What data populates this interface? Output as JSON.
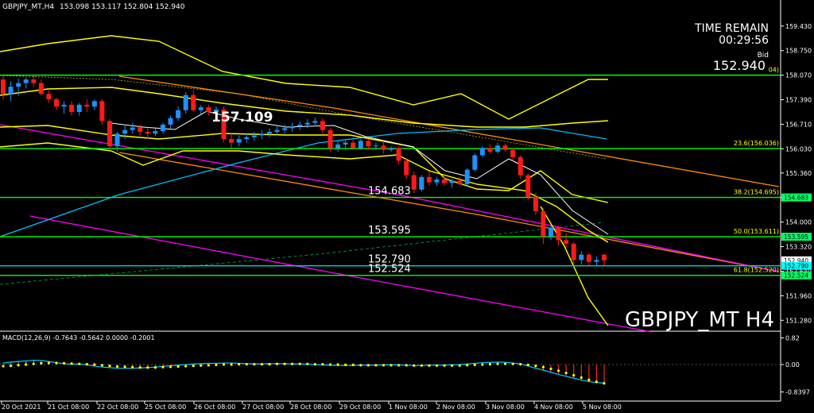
{
  "header": {
    "symbol": "GBPJPY_MT,H4",
    "ohlc": "153.098 153.117 152.804 152.940"
  },
  "watermark": "GBPJPY_MT H4",
  "timer": {
    "label": "TIME REMAIN",
    "value": "00:29:56",
    "bid_label": "Bid",
    "bid_value": "152.940"
  },
  "colors": {
    "background": "#000000",
    "bull": "#1e90ff",
    "bear": "#ff1a1a",
    "level_line": "#00ff00",
    "trend_upper": "#ff8c00",
    "trend_channel": "#ff00ff",
    "envelope": "#ffff00",
    "ma_fast": "#ffffff",
    "ma_slow": "#00bfff",
    "macd_signal": "#ffff00",
    "macd_main": "#00ccff"
  },
  "chart_data": {
    "type": "candlestick",
    "price_axis": {
      "ticks": [
        "159.430",
        "158.750",
        "158.070",
        "157.390",
        "156.710",
        "156.030",
        "155.360",
        "154.680",
        "154.000",
        "153.320",
        "152.640",
        "151.960",
        "151.280"
      ],
      "ylim": [
        151.0,
        159.8
      ]
    },
    "time_axis": {
      "ticks": [
        "20 Oct 2021",
        "21 Oct 08:00",
        "22 Oct 08:00",
        "25 Oct 08:00",
        "26 Oct 08:00",
        "27 Oct 08:00",
        "28 Oct 08:00",
        "29 Oct 08:00",
        "1 Nov 08:00",
        "2 Nov 08:00",
        "3 Nov 08:00",
        "4 Nov 08:00",
        "5 Nov 08:00"
      ]
    },
    "candles": [
      [
        157.95,
        158.05,
        157.4,
        157.55
      ],
      [
        157.55,
        157.9,
        157.35,
        157.75
      ],
      [
        157.75,
        157.98,
        157.5,
        157.85
      ],
      [
        157.85,
        158.0,
        157.7,
        157.95
      ],
      [
        157.95,
        158.05,
        157.75,
        157.85
      ],
      [
        157.85,
        157.95,
        157.5,
        157.55
      ],
      [
        157.55,
        157.65,
        157.3,
        157.4
      ],
      [
        157.4,
        157.45,
        157.1,
        157.2
      ],
      [
        157.2,
        157.35,
        157.0,
        157.25
      ],
      [
        157.25,
        157.35,
        156.95,
        157.05
      ],
      [
        157.05,
        157.3,
        156.95,
        157.25
      ],
      [
        157.25,
        157.4,
        157.05,
        157.2
      ],
      [
        157.2,
        157.4,
        157.1,
        157.35
      ],
      [
        157.35,
        157.4,
        156.7,
        156.8
      ],
      [
        156.8,
        156.85,
        156.0,
        156.1
      ],
      [
        156.1,
        156.5,
        155.95,
        156.45
      ],
      [
        156.45,
        156.7,
        156.3,
        156.55
      ],
      [
        156.55,
        156.75,
        156.45,
        156.62
      ],
      [
        156.62,
        156.7,
        156.4,
        156.5
      ],
      [
        156.5,
        156.62,
        156.3,
        156.45
      ],
      [
        156.45,
        156.6,
        156.38,
        156.52
      ],
      [
        156.52,
        156.75,
        156.45,
        156.7
      ],
      [
        156.7,
        156.95,
        156.6,
        156.88
      ],
      [
        156.88,
        157.2,
        156.8,
        157.1
      ],
      [
        157.1,
        157.6,
        157.0,
        157.52
      ],
      [
        157.52,
        157.65,
        157.05,
        157.1
      ],
      [
        157.1,
        157.25,
        157.0,
        157.18
      ],
      [
        157.18,
        157.25,
        156.95,
        157.05
      ],
      [
        157.05,
        157.2,
        156.95,
        157.12
      ],
      [
        157.12,
        157.2,
        156.2,
        156.3
      ],
      [
        156.3,
        156.45,
        156.05,
        156.2
      ],
      [
        156.2,
        156.4,
        156.1,
        156.3
      ],
      [
        156.3,
        156.45,
        156.2,
        156.35
      ],
      [
        156.35,
        156.5,
        156.25,
        156.4
      ],
      [
        156.4,
        156.55,
        156.3,
        156.45
      ],
      [
        156.45,
        156.6,
        156.35,
        156.5
      ],
      [
        156.5,
        156.65,
        156.4,
        156.55
      ],
      [
        156.55,
        156.7,
        156.45,
        156.6
      ],
      [
        156.6,
        156.75,
        156.5,
        156.65
      ],
      [
        156.65,
        156.8,
        156.55,
        156.7
      ],
      [
        156.7,
        156.85,
        156.6,
        156.75
      ],
      [
        156.75,
        156.9,
        156.65,
        156.8
      ],
      [
        156.8,
        156.88,
        156.45,
        156.55
      ],
      [
        156.55,
        156.6,
        155.95,
        156.05
      ],
      [
        156.05,
        156.25,
        155.95,
        156.15
      ],
      [
        156.15,
        156.3,
        156.0,
        156.2
      ],
      [
        156.2,
        156.3,
        156.0,
        156.05
      ],
      [
        156.05,
        156.3,
        156.0,
        156.25
      ],
      [
        156.25,
        156.3,
        156.0,
        156.1
      ],
      [
        156.1,
        156.2,
        156.0,
        156.12
      ],
      [
        156.12,
        156.25,
        155.9,
        156.0
      ],
      [
        156.0,
        156.1,
        155.95,
        156.05
      ],
      [
        156.05,
        156.1,
        155.6,
        155.7
      ],
      [
        155.7,
        155.75,
        155.2,
        155.3
      ],
      [
        155.3,
        155.4,
        154.8,
        154.9
      ],
      [
        154.9,
        155.3,
        154.85,
        155.25
      ],
      [
        155.25,
        155.4,
        155.0,
        155.1
      ],
      [
        155.1,
        155.25,
        155.0,
        155.18
      ],
      [
        155.18,
        155.25,
        155.0,
        155.08
      ],
      [
        155.08,
        155.2,
        154.95,
        155.15
      ],
      [
        155.15,
        155.25,
        155.0,
        155.05
      ],
      [
        155.05,
        155.5,
        155.0,
        155.45
      ],
      [
        155.45,
        155.9,
        155.4,
        155.85
      ],
      [
        155.85,
        156.1,
        155.8,
        156.05
      ],
      [
        156.05,
        156.15,
        155.9,
        155.95
      ],
      [
        155.95,
        156.2,
        155.9,
        156.12
      ],
      [
        156.12,
        156.18,
        155.95,
        156.0
      ],
      [
        156.0,
        156.05,
        155.7,
        155.8
      ],
      [
        155.8,
        155.85,
        155.2,
        155.3
      ],
      [
        155.3,
        155.35,
        154.6,
        154.7
      ],
      [
        154.7,
        154.8,
        154.2,
        154.3
      ],
      [
        154.3,
        154.4,
        153.4,
        153.6
      ],
      [
        153.6,
        153.9,
        153.5,
        153.85
      ],
      [
        153.85,
        153.9,
        153.35,
        153.5
      ],
      [
        153.5,
        153.7,
        153.3,
        153.4
      ],
      [
        153.4,
        153.45,
        152.8,
        152.95
      ],
      [
        152.95,
        153.2,
        152.85,
        153.1
      ],
      [
        153.1,
        153.15,
        152.8,
        152.9
      ],
      [
        152.9,
        153.05,
        152.8,
        152.95
      ],
      [
        153.098,
        153.117,
        152.804,
        152.94
      ]
    ],
    "levels": [
      {
        "price": 158.07,
        "label": ""
      },
      {
        "price": 156.036,
        "label": "23.6(156.036)"
      },
      {
        "price": 154.683,
        "label": "154.683",
        "fib": "38.2(154.695)"
      },
      {
        "price": 153.595,
        "label": "153.595",
        "fib": "50.0(153.611)"
      },
      {
        "price": 152.79,
        "label": "152.790"
      },
      {
        "price": 152.524,
        "label": "152.524",
        "fib": "61.8(152.520)"
      }
    ],
    "top_level_suffix": "04)",
    "annotation": "157.109",
    "axis_badges": [
      {
        "text": "154.683",
        "price": 154.683,
        "color": "#00ff66"
      },
      {
        "text": "153.595",
        "price": 153.595,
        "color": "#00ff66"
      },
      {
        "text": "152.940",
        "price": 152.94,
        "color": "#ffffff"
      },
      {
        "text": "152.790",
        "price": 152.79,
        "color": "#00ffff"
      },
      {
        "text": "152.524",
        "price": 152.524,
        "color": "#00ff66"
      }
    ],
    "macd": {
      "label": "MACD(12,26,9) -0.7643 -0.5642 0.0000 -0.2001",
      "ticks": [
        "0.82",
        "0.00",
        "-0.8397"
      ],
      "ylim": [
        -1.0,
        1.0
      ],
      "hist": [
        0.05,
        0.08,
        0.1,
        0.12,
        0.14,
        0.13,
        0.1,
        0.06,
        0.03,
        0.01,
        0.02,
        -0.01,
        -0.05,
        -0.08,
        -0.1,
        -0.12,
        -0.12,
        -0.12,
        -0.11,
        -0.1,
        -0.08,
        -0.06,
        -0.04,
        -0.02,
        0.0,
        0.02,
        0.03,
        0.04,
        0.04,
        0.05,
        0.05,
        0.04,
        0.03,
        0.02,
        0.02,
        0.03,
        0.03,
        0.03,
        0.02,
        0.02,
        0.01,
        0.0,
        -0.01,
        -0.02,
        -0.03,
        -0.03,
        -0.03,
        -0.02,
        -0.02,
        -0.02,
        -0.01,
        -0.01,
        -0.01,
        -0.02,
        -0.03,
        -0.03,
        -0.02,
        -0.02,
        -0.02,
        -0.01,
        0.0,
        0.02,
        0.04,
        0.06,
        0.07,
        0.08,
        0.07,
        0.05,
        0.02,
        -0.05,
        -0.12,
        -0.18,
        -0.25,
        -0.32,
        -0.38,
        -0.44,
        -0.5,
        -0.55,
        -0.58,
        -0.6
      ],
      "signal": [
        -0.05,
        -0.04,
        -0.02,
        0.0,
        0.02,
        0.04,
        0.05,
        0.05,
        0.04,
        0.03,
        0.02,
        0.01,
        0.0,
        -0.02,
        -0.04,
        -0.06,
        -0.07,
        -0.08,
        -0.09,
        -0.09,
        -0.09,
        -0.08,
        -0.07,
        -0.06,
        -0.05,
        -0.04,
        -0.03,
        -0.02,
        -0.01,
        0.0,
        0.0,
        0.01,
        0.01,
        0.01,
        0.01,
        0.01,
        0.02,
        0.02,
        0.02,
        0.02,
        0.02,
        0.01,
        0.01,
        0.0,
        0.0,
        -0.01,
        -0.01,
        -0.02,
        -0.02,
        -0.02,
        -0.02,
        -0.02,
        -0.02,
        -0.02,
        -0.03,
        -0.03,
        -0.03,
        -0.03,
        -0.03,
        -0.03,
        -0.03,
        -0.02,
        -0.01,
        0.0,
        0.01,
        0.02,
        0.02,
        0.02,
        0.01,
        -0.01,
        -0.04,
        -0.08,
        -0.13,
        -0.19,
        -0.26,
        -0.33,
        -0.4,
        -0.47,
        -0.53,
        -0.58
      ]
    }
  }
}
